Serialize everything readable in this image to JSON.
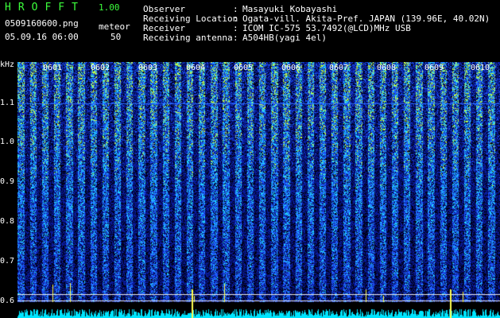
{
  "header": {
    "app_name": "HROFFT",
    "app_version": "1.00",
    "filename": "0509160600.png",
    "datetime": "05.09.16 06:00",
    "meteor_label": "meteor",
    "meteor_count": "50"
  },
  "info": [
    {
      "label": "Observer",
      "value": "Masayuki Kobayashi"
    },
    {
      "label": "Receiving Location",
      "value": "Ogata-vill. Akita-Pref. JAPAN (139.96E, 40.02N)"
    },
    {
      "label": "Receiver",
      "value": "ICOM IC-575 53.7492(@LCD)MHz USB"
    },
    {
      "label": "Receiving antenna",
      "value": "A504HB(yagi 4el)"
    }
  ],
  "spectrogram": {
    "y_unit": "kHz",
    "y_ticks": [
      "1.1",
      "1.0",
      "0.9",
      "0.8",
      "0.7",
      "0.6"
    ],
    "time_marks": [
      "0601",
      "0602",
      "0603",
      "0604",
      "0605",
      "0606",
      "0607",
      "0608",
      "0609",
      "0610"
    ],
    "colors": {
      "background": "#000000",
      "low": "#0a1a9a",
      "mid": "#1f5cff",
      "high": "#22d2ff",
      "peak": "#c8ff3c",
      "baseline": "#00e5ff",
      "echo": "#ffff50"
    }
  }
}
